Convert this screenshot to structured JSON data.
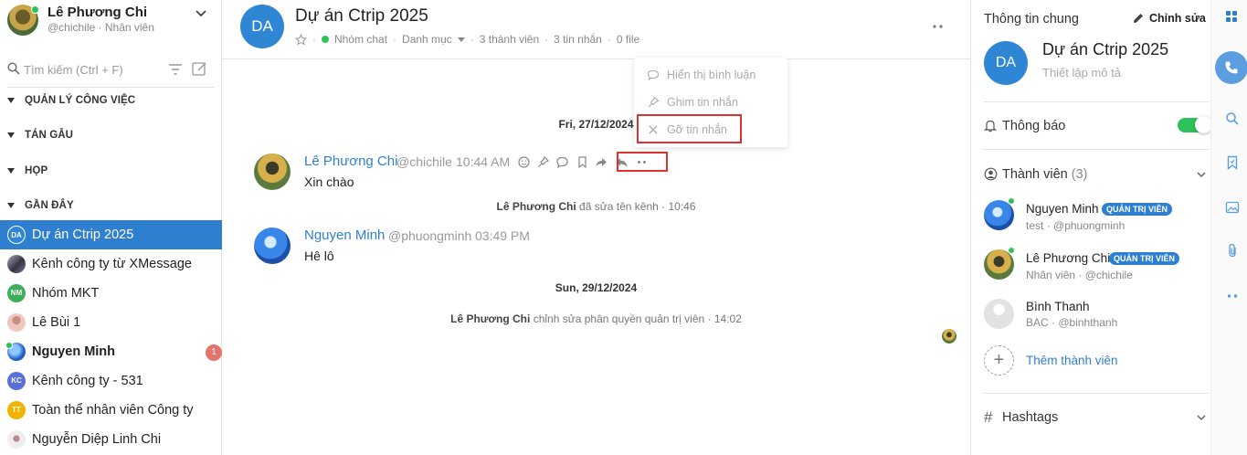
{
  "user": {
    "name": "Lê Phương Chi",
    "subtitle": "@chichile · Nhân viên"
  },
  "search": {
    "placeholder": "Tìm kiếm (Ctrl + F)"
  },
  "sections": [
    {
      "label": "QUẢN LÝ CÔNG VIỆC"
    },
    {
      "label": "TÁN GẪU"
    },
    {
      "label": "HỌP"
    },
    {
      "label": "GẦN ĐÂY"
    }
  ],
  "channels": [
    {
      "initials": "DA",
      "name": "Dự án Ctrip 2025",
      "color": "#2f86d4",
      "active": true
    },
    {
      "initials": "",
      "name": "Kênh công ty từ XMessage",
      "color": "#445"
    },
    {
      "initials": "NM",
      "name": "Nhóm MKT",
      "color": "#3fae5a"
    },
    {
      "initials": "",
      "name": "Lê Bùi 1",
      "color": "#e8b0a8"
    },
    {
      "initials": "",
      "name": "Nguyen Minh",
      "color": "#2a6fd0",
      "unread": "1"
    },
    {
      "initials": "KC",
      "name": "Kênh công ty - 531",
      "color": "#5b6fd8"
    },
    {
      "initials": "TT",
      "name": "Toàn thể nhân viên Công ty",
      "color": "#f0b400"
    },
    {
      "initials": "",
      "name": "Nguyễn Diệp Linh Chi",
      "color": "#ddd"
    }
  ],
  "header": {
    "initials": "DA",
    "title": "Dự án Ctrip 2025",
    "type": "Nhóm chat",
    "category": "Danh mục",
    "members": "3 thành viên",
    "messages": "3 tin nhắn",
    "files": "0 file"
  },
  "feed": {
    "date1": "Fri, 27/12/2024",
    "date2": "Sun, 29/12/2024",
    "msg1": {
      "name": "Lê Phương Chi",
      "handle": "@chichile",
      "time": "10:44 AM",
      "text": "Xin chào"
    },
    "sys1": {
      "actor": "Lê Phương Chi",
      "text": "đã sửa tên kênh · 10:46"
    },
    "msg2": {
      "name": "Nguyen Minh",
      "handle": "@phuongminh",
      "time": "03:49 PM",
      "text": "Hê lô"
    },
    "sys2": {
      "actor": "Lê Phương Chi",
      "text": "chỉnh sửa phân quyền quản trị viên · 14:02"
    }
  },
  "context_menu": {
    "show_comments": "Hiển thị bình luận",
    "pin": "Ghim tin nhắn",
    "remove": "Gỡ tin nhắn"
  },
  "info_panel": {
    "title": "Thông tin chung",
    "edit": "Chỉnh sửa",
    "initials": "DA",
    "name": "Dự án Ctrip 2025",
    "description": "Thiết lập mô tả",
    "notifications": "Thông báo",
    "members_label": "Thành viên",
    "members_count": "(3)",
    "members": [
      {
        "name": "Nguyen Minh",
        "role": "QUẢN TRỊ VIÊN",
        "sub": "test · @phuongminh"
      },
      {
        "name": "Lê Phương Chi",
        "role": "QUẢN TRỊ VIÊN",
        "sub": "Nhân viên · @chichile"
      },
      {
        "name": "Bình Thanh",
        "role": "",
        "sub": "BAC · @binhthanh"
      }
    ],
    "add_member": "Thêm thành viên",
    "hashtags": "Hashtags"
  },
  "colors": {
    "accent": "#2f7fd1",
    "online": "#2ec35a",
    "highlight": "#e03131"
  }
}
